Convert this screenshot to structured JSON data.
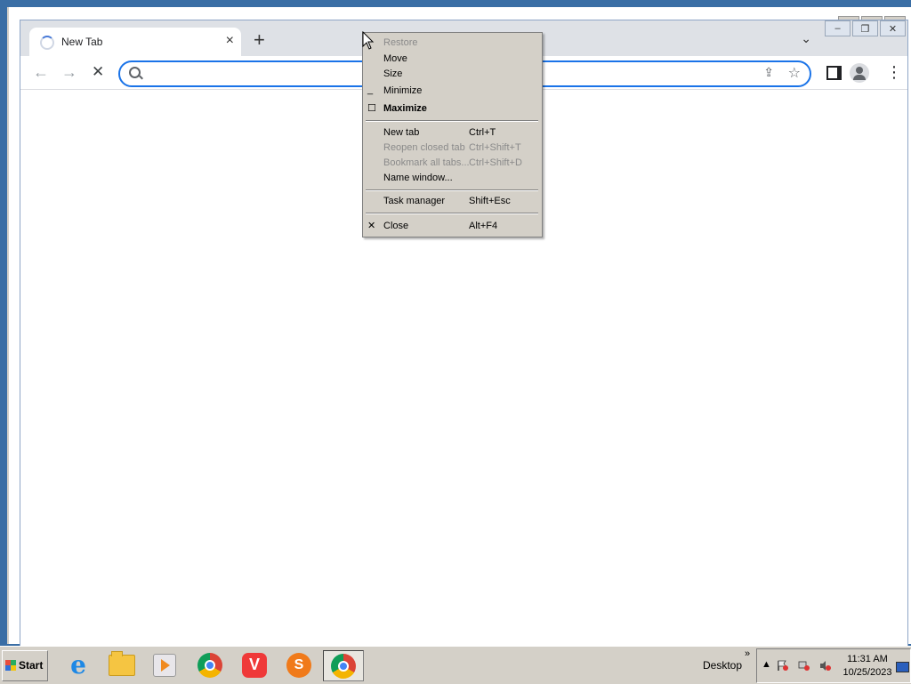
{
  "browser": {
    "tab": {
      "title": "New Tab",
      "close_glyph": "×"
    },
    "new_tab_glyph": "+",
    "tab_search_glyph": "⌄",
    "window_buttons": [
      "–",
      "❐",
      "✕"
    ],
    "omnibox": {
      "value": "",
      "placeholder": ""
    }
  },
  "background_window": {
    "buttons": [
      "–",
      "❐",
      "✕"
    ]
  },
  "context_menu": {
    "items": [
      {
        "label": "Restore",
        "shortcut": "",
        "disabled": true,
        "mark": ""
      },
      {
        "label": "Move",
        "shortcut": "",
        "disabled": false,
        "mark": ""
      },
      {
        "label": "Size",
        "shortcut": "",
        "disabled": false,
        "mark": ""
      },
      {
        "label": "Minimize",
        "shortcut": "",
        "disabled": false,
        "mark": "_"
      },
      {
        "label": "Maximize",
        "shortcut": "",
        "disabled": false,
        "mark": "☐",
        "bold": true
      },
      {
        "label": "New tab",
        "shortcut": "Ctrl+T",
        "disabled": false,
        "mark": ""
      },
      {
        "label": "Reopen closed tab",
        "shortcut": "Ctrl+Shift+T",
        "disabled": true,
        "mark": ""
      },
      {
        "label": "Bookmark all tabs...",
        "shortcut": "Ctrl+Shift+D",
        "disabled": true,
        "mark": ""
      },
      {
        "label": "Name window...",
        "shortcut": "",
        "disabled": false,
        "mark": ""
      },
      {
        "label": "Task manager",
        "shortcut": "Shift+Esc",
        "disabled": false,
        "mark": ""
      },
      {
        "label": "Close",
        "shortcut": "Alt+F4",
        "disabled": false,
        "mark": "✕"
      }
    ]
  },
  "taskbar": {
    "start_label": "Start",
    "apps": [
      "internet-explorer",
      "file-explorer",
      "media-player",
      "chrome",
      "vivaldi",
      "sublime",
      "chrome"
    ],
    "vivaldi_glyph": "V",
    "sublime_glyph": "S",
    "desktop_label": "Desktop",
    "chevron": "»",
    "tray_up": "▲",
    "clock": {
      "time": "11:31 AM",
      "date": "10/25/2023"
    }
  },
  "colors": {
    "desktop": "#3a6ea5",
    "accent": "#1a73e8",
    "menu_bg": "#d4d0c8",
    "disabled_text": "#8a8a8a"
  }
}
